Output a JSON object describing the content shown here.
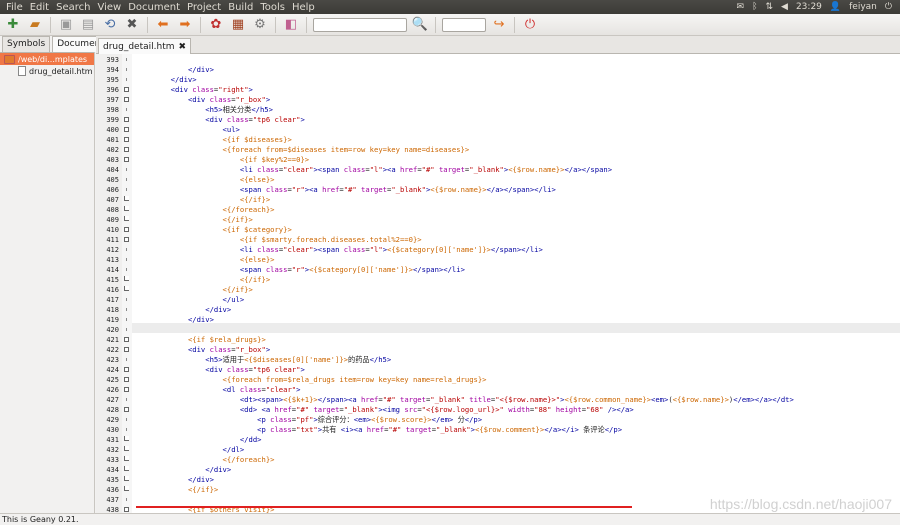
{
  "menubar": {
    "items": [
      "File",
      "Edit",
      "Search",
      "View",
      "Document",
      "Project",
      "Build",
      "Tools",
      "Help"
    ],
    "time": "23:29",
    "user": "feiyan"
  },
  "toolbar": {
    "icons": [
      "new-file-icon",
      "open-file-icon",
      "save-icon",
      "save-all-icon",
      "revert-icon",
      "close-icon",
      "back-icon",
      "forward-icon",
      "compile-icon",
      "build-icon",
      "run-icon",
      "color-icon",
      "search-icon",
      "goto-line-icon",
      "quit-icon"
    ],
    "search_value": "",
    "goto_value": ""
  },
  "sidebar": {
    "tabs": [
      "Symbols",
      "Documents"
    ],
    "folder": "/web/di...mplates",
    "file": "drug_detail.htm"
  },
  "document": {
    "tab": "drug_detail.htm"
  },
  "lines": [
    {
      "n": "393",
      "f": "dot",
      "h": ""
    },
    {
      "n": "394",
      "f": "dot",
      "h": "            <span class='t'>&lt;/div&gt;</span>"
    },
    {
      "n": "395",
      "f": "dot",
      "h": "        <span class='t'>&lt;/div&gt;</span>"
    },
    {
      "n": "396",
      "f": "box",
      "h": "        <span class='t'>&lt;div</span> <span class='a'>class</span>=<span class='s'>\"right\"</span><span class='t'>&gt;</span>"
    },
    {
      "n": "397",
      "f": "box",
      "h": "            <span class='t'>&lt;div</span> <span class='a'>class</span>=<span class='s'>\"r_box\"</span><span class='t'>&gt;</span>"
    },
    {
      "n": "398",
      "f": "dot",
      "h": "                <span class='t'>&lt;h5&gt;</span>相关分类<span class='t'>&lt;/h5&gt;</span>"
    },
    {
      "n": "399",
      "f": "box",
      "h": "                <span class='t'>&lt;div</span> <span class='a'>class</span>=<span class='s'>\"tp6 clear\"</span><span class='t'>&gt;</span>"
    },
    {
      "n": "400",
      "f": "box",
      "h": "                    <span class='t'>&lt;ul&gt;</span>"
    },
    {
      "n": "401",
      "f": "box",
      "h": "                    <span class='x'>&lt;{if $diseases}&gt;</span>"
    },
    {
      "n": "402",
      "f": "box",
      "h": "                    <span class='x'>&lt;{foreach from=$diseases item=row key=key name=diseases}&gt;</span>"
    },
    {
      "n": "403",
      "f": "box",
      "h": "                        <span class='x'>&lt;{if $key%2==0}&gt;</span>"
    },
    {
      "n": "404",
      "f": "dot",
      "h": "                        <span class='t'>&lt;li</span> <span class='a'>class</span>=<span class='s'>\"clear\"</span><span class='t'>&gt;&lt;span</span> <span class='a'>class</span>=<span class='s'>\"l\"</span><span class='t'>&gt;&lt;a</span> <span class='a'>href</span>=<span class='s'>\"#\"</span> <span class='a'>target</span>=<span class='s'>\"_blank\"</span><span class='t'>&gt;</span><span class='v'>&lt;{$row.name}&gt;</span><span class='t'>&lt;/a&gt;&lt;/span&gt;</span>"
    },
    {
      "n": "405",
      "f": "dot",
      "h": "                        <span class='x'>&lt;{else}&gt;</span>"
    },
    {
      "n": "406",
      "f": "dot",
      "h": "                        <span class='t'>&lt;span</span> <span class='a'>class</span>=<span class='s'>\"r\"</span><span class='t'>&gt;&lt;a</span> <span class='a'>href</span>=<span class='s'>\"#\"</span> <span class='a'>target</span>=<span class='s'>\"_blank\"</span><span class='t'>&gt;</span><span class='v'>&lt;{$row.name}&gt;</span><span class='t'>&lt;/a&gt;&lt;/span&gt;&lt;/li&gt;</span>"
    },
    {
      "n": "407",
      "f": "end",
      "h": "                        <span class='x'>&lt;{/if}&gt;</span>"
    },
    {
      "n": "408",
      "f": "end",
      "h": "                    <span class='x'>&lt;{/foreach}&gt;</span>"
    },
    {
      "n": "409",
      "f": "end",
      "h": "                    <span class='x'>&lt;{/if}&gt;</span>"
    },
    {
      "n": "410",
      "f": "box",
      "h": "                    <span class='x'>&lt;{if $category}&gt;</span>"
    },
    {
      "n": "411",
      "f": "box",
      "h": "                        <span class='x'>&lt;{if $smarty.foreach.diseases.total%2==0}&gt;</span>"
    },
    {
      "n": "412",
      "f": "dot",
      "h": "                        <span class='t'>&lt;li</span> <span class='a'>class</span>=<span class='s'>\"clear\"</span><span class='t'>&gt;&lt;span</span> <span class='a'>class</span>=<span class='s'>\"l\"</span><span class='t'>&gt;</span><span class='v'>&lt;{$category[0]['name']}&gt;</span><span class='t'>&lt;/span&gt;&lt;/li&gt;</span>"
    },
    {
      "n": "413",
      "f": "dot",
      "h": "                        <span class='x'>&lt;{else}&gt;</span>"
    },
    {
      "n": "414",
      "f": "dot",
      "h": "                        <span class='t'>&lt;span</span> <span class='a'>class</span>=<span class='s'>\"r\"</span><span class='t'>&gt;</span><span class='v'>&lt;{$category[0]['name']}&gt;</span><span class='t'>&lt;/span&gt;&lt;/li&gt;</span>"
    },
    {
      "n": "415",
      "f": "end",
      "h": "                        <span class='x'>&lt;{/if}&gt;</span>"
    },
    {
      "n": "416",
      "f": "end",
      "h": "                    <span class='x'>&lt;{/if}&gt;</span>"
    },
    {
      "n": "417",
      "f": "dot",
      "h": "                    <span class='t'>&lt;/ul&gt;</span>"
    },
    {
      "n": "418",
      "f": "dot",
      "h": "                <span class='t'>&lt;/div&gt;</span>"
    },
    {
      "n": "419",
      "f": "dot",
      "h": "            <span class='t'>&lt;/div&gt;</span>"
    },
    {
      "n": "420",
      "f": "dot",
      "h": ""
    },
    {
      "n": "421",
      "f": "box",
      "h": "            <span class='x'>&lt;{if $rela_drugs}&gt;</span>"
    },
    {
      "n": "422",
      "f": "box",
      "h": "            <span class='t'>&lt;div</span> <span class='a'>class</span>=<span class='s'>\"r_box\"</span><span class='t'>&gt;</span>"
    },
    {
      "n": "423",
      "f": "dot",
      "h": "                <span class='t'>&lt;h5&gt;</span>适用于<span class='v'>&lt;{$diseases[0]['name']}&gt;</span>的药品<span class='t'>&lt;/h5&gt;</span>"
    },
    {
      "n": "424",
      "f": "box",
      "h": "                <span class='t'>&lt;div</span> <span class='a'>class</span>=<span class='s'>\"tp6 clear\"</span><span class='t'>&gt;</span>"
    },
    {
      "n": "425",
      "f": "box",
      "h": "                    <span class='x'>&lt;{foreach from=$rela_drugs item=row key=key name=rela_drugs}&gt;</span>"
    },
    {
      "n": "426",
      "f": "box",
      "h": "                    <span class='t'>&lt;dl</span> <span class='a'>class</span>=<span class='s'>\"clear\"</span><span class='t'>&gt;</span>"
    },
    {
      "n": "427",
      "f": "dot",
      "h": "                        <span class='t'>&lt;dt&gt;&lt;span&gt;</span><span class='v'>&lt;{$k+1}&gt;</span><span class='t'>&lt;/span&gt;&lt;a</span> <span class='a'>href</span>=<span class='s'>\"#\"</span> <span class='a'>target</span>=<span class='s'>\"_blank\"</span> <span class='a'>title</span>=<span class='s'>\"&lt;{$row.name}&gt;\"</span><span class='t'>&gt;</span><span class='v'>&lt;{$row.common_name}&gt;</span><span class='t'>&lt;em&gt;</span>(<span class='v'>&lt;{$row.name}&gt;</span>)<span class='t'>&lt;/em&gt;&lt;/a&gt;&lt;/dt&gt;</span>"
    },
    {
      "n": "428",
      "f": "box",
      "h": "                        <span class='t'>&lt;dd&gt;</span> <span class='t'>&lt;a</span> <span class='a'>href</span>=<span class='s'>\"#\"</span> <span class='a'>target</span>=<span class='s'>\"_blank\"</span><span class='t'>&gt;&lt;img</span> <span class='a'>src</span>=<span class='s'>\"&lt;{$row.logo_url}&gt;\"</span> <span class='a'>width</span>=<span class='s'>\"88\"</span> <span class='a'>height</span>=<span class='s'>\"68\"</span> <span class='t'>/&gt;&lt;/a&gt;</span>"
    },
    {
      "n": "429",
      "f": "dot",
      "h": "                            <span class='t'>&lt;p</span> <span class='a'>class</span>=<span class='s'>\"pf\"</span><span class='t'>&gt;</span>综合评分：<span class='t'>&lt;em&gt;</span><span class='v'>&lt;{$row.score}&gt;</span><span class='t'>&lt;/em&gt;</span> 分<span class='t'>&lt;/p&gt;</span>"
    },
    {
      "n": "430",
      "f": "dot",
      "h": "                            <span class='t'>&lt;p</span> <span class='a'>class</span>=<span class='s'>\"txt\"</span><span class='t'>&gt;</span>共有 <span class='t'>&lt;i&gt;&lt;a</span> <span class='a'>href</span>=<span class='s'>\"#\"</span> <span class='a'>target</span>=<span class='s'>\"_blank\"</span><span class='t'>&gt;</span><span class='v'>&lt;{$row.comment}&gt;</span><span class='t'>&lt;/a&gt;&lt;/i&gt;</span> 条评论<span class='t'>&lt;/p&gt;</span>"
    },
    {
      "n": "431",
      "f": "end",
      "h": "                        <span class='t'>&lt;/dd&gt;</span>"
    },
    {
      "n": "432",
      "f": "end",
      "h": "                    <span class='t'>&lt;/dl&gt;</span>"
    },
    {
      "n": "433",
      "f": "end",
      "h": "                    <span class='x'>&lt;{/foreach}&gt;</span>"
    },
    {
      "n": "434",
      "f": "end",
      "h": "                <span class='t'>&lt;/div&gt;</span>"
    },
    {
      "n": "435",
      "f": "end",
      "h": "            <span class='t'>&lt;/div&gt;</span>"
    },
    {
      "n": "436",
      "f": "end",
      "h": "            <span class='x'>&lt;{/if}&gt;</span>"
    },
    {
      "n": "437",
      "f": "dot",
      "h": ""
    },
    {
      "n": "438",
      "f": "box",
      "h": "            <span class='x'>&lt;{if $others_visit}&gt;</span>"
    }
  ],
  "statusbar": {
    "text": "This is Geany 0.21."
  },
  "watermark": "https://blog.csdn.net/haoji007"
}
